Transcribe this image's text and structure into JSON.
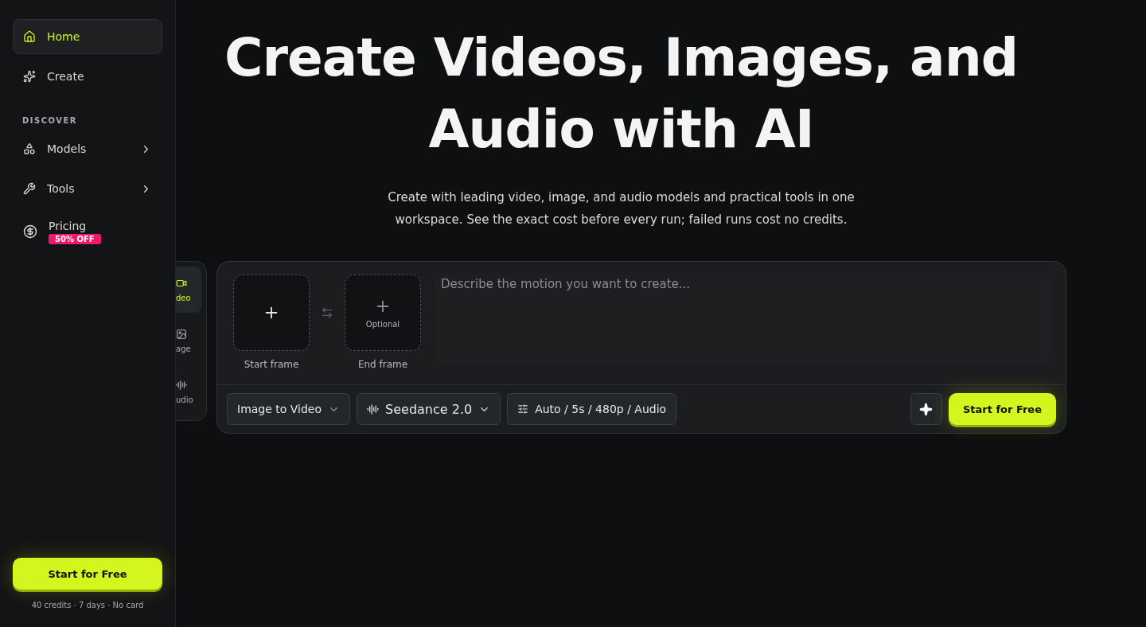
{
  "sidebar": {
    "items": [
      {
        "kind": "nav",
        "label": "Home",
        "selected": true
      },
      {
        "kind": "nav",
        "label": "Create",
        "selected": false
      },
      {
        "kind": "heading",
        "label": "DISCOVER"
      },
      {
        "kind": "menu",
        "label": "Models",
        "selected": false
      },
      {
        "kind": "menu",
        "label": "Tools",
        "selected": false
      },
      {
        "kind": "badge",
        "label": "Pricing",
        "badge": "50% OFF",
        "selected": false
      }
    ],
    "cta": "Start for Free",
    "note": "40 credits · 7 days · No card"
  },
  "hero": {
    "title": "Create Videos, Images, and Audio with AI",
    "subtitle": "Create with leading video, image, and audio models and practical tools in one workspace. See the exact cost before every run; failed runs cost no credits."
  },
  "modes": [
    {
      "label": "deo",
      "selected": true
    },
    {
      "label": "age",
      "selected": false
    },
    {
      "label": "udio",
      "selected": false
    }
  ],
  "composer": {
    "start_frame": {
      "label": "Start frame"
    },
    "end_frame": {
      "label": "End frame",
      "hint": "Optional"
    },
    "prompt": {
      "placeholder": "Describe the motion you want to create..."
    },
    "mode_select": "Image to Video",
    "model_select": "Seedance 2.0",
    "settings": "Auto / 5s / 480p / Audio",
    "cta": "Start for Free"
  }
}
